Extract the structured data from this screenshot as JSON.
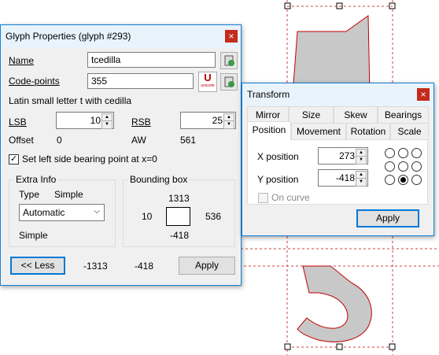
{
  "glyph_dialog": {
    "title": "Glyph Properties (glyph #293)",
    "close": "×",
    "name_label": "Name",
    "name_value": "tcedilla",
    "codepoints_label": "Code-points",
    "codepoints_value": "355",
    "unicode_icon_text": "U",
    "unicode_icon_sub": "unicode",
    "description": "Latin small letter t with cedilla",
    "lsb_label": "LSB",
    "lsb_value": "10",
    "rsb_label": "RSB",
    "rsb_value": "25",
    "offset_label": "Offset",
    "offset_value": "0",
    "aw_label": "AW",
    "aw_value": "561",
    "set_lsb_checkbox": "Set left side bearing point at x=0",
    "set_lsb_checked": true,
    "extra_info": {
      "legend": "Extra Info",
      "type_label": "Type",
      "type_value": "Simple",
      "combo_value": "Automatic",
      "bottom_text": "Simple"
    },
    "bbox": {
      "legend": "Bounding box",
      "top": "1313",
      "left": "10",
      "right": "536",
      "bottom": "-418"
    },
    "less_button": "<< Less",
    "value_a": "-1313",
    "value_b": "-418",
    "apply_button": "Apply"
  },
  "transform_dialog": {
    "title": "Transform",
    "close": "×",
    "tabs_row1": [
      "Mirror",
      "Size",
      "Skew",
      "Bearings"
    ],
    "tabs_row2": [
      "Position",
      "Movement",
      "Rotation",
      "Scale"
    ],
    "selected_tab": "Position",
    "x_label": "X position",
    "x_value": "273",
    "y_label": "Y position",
    "y_value": "-418",
    "on_curve_label": "On curve",
    "apply_button": "Apply"
  },
  "colors": {
    "glyph_fill": "#c8c8c8",
    "glyph_outline": "#c00000",
    "guide": "#d04040",
    "accent": "#0078d7",
    "close_red": "#c42b1c"
  }
}
